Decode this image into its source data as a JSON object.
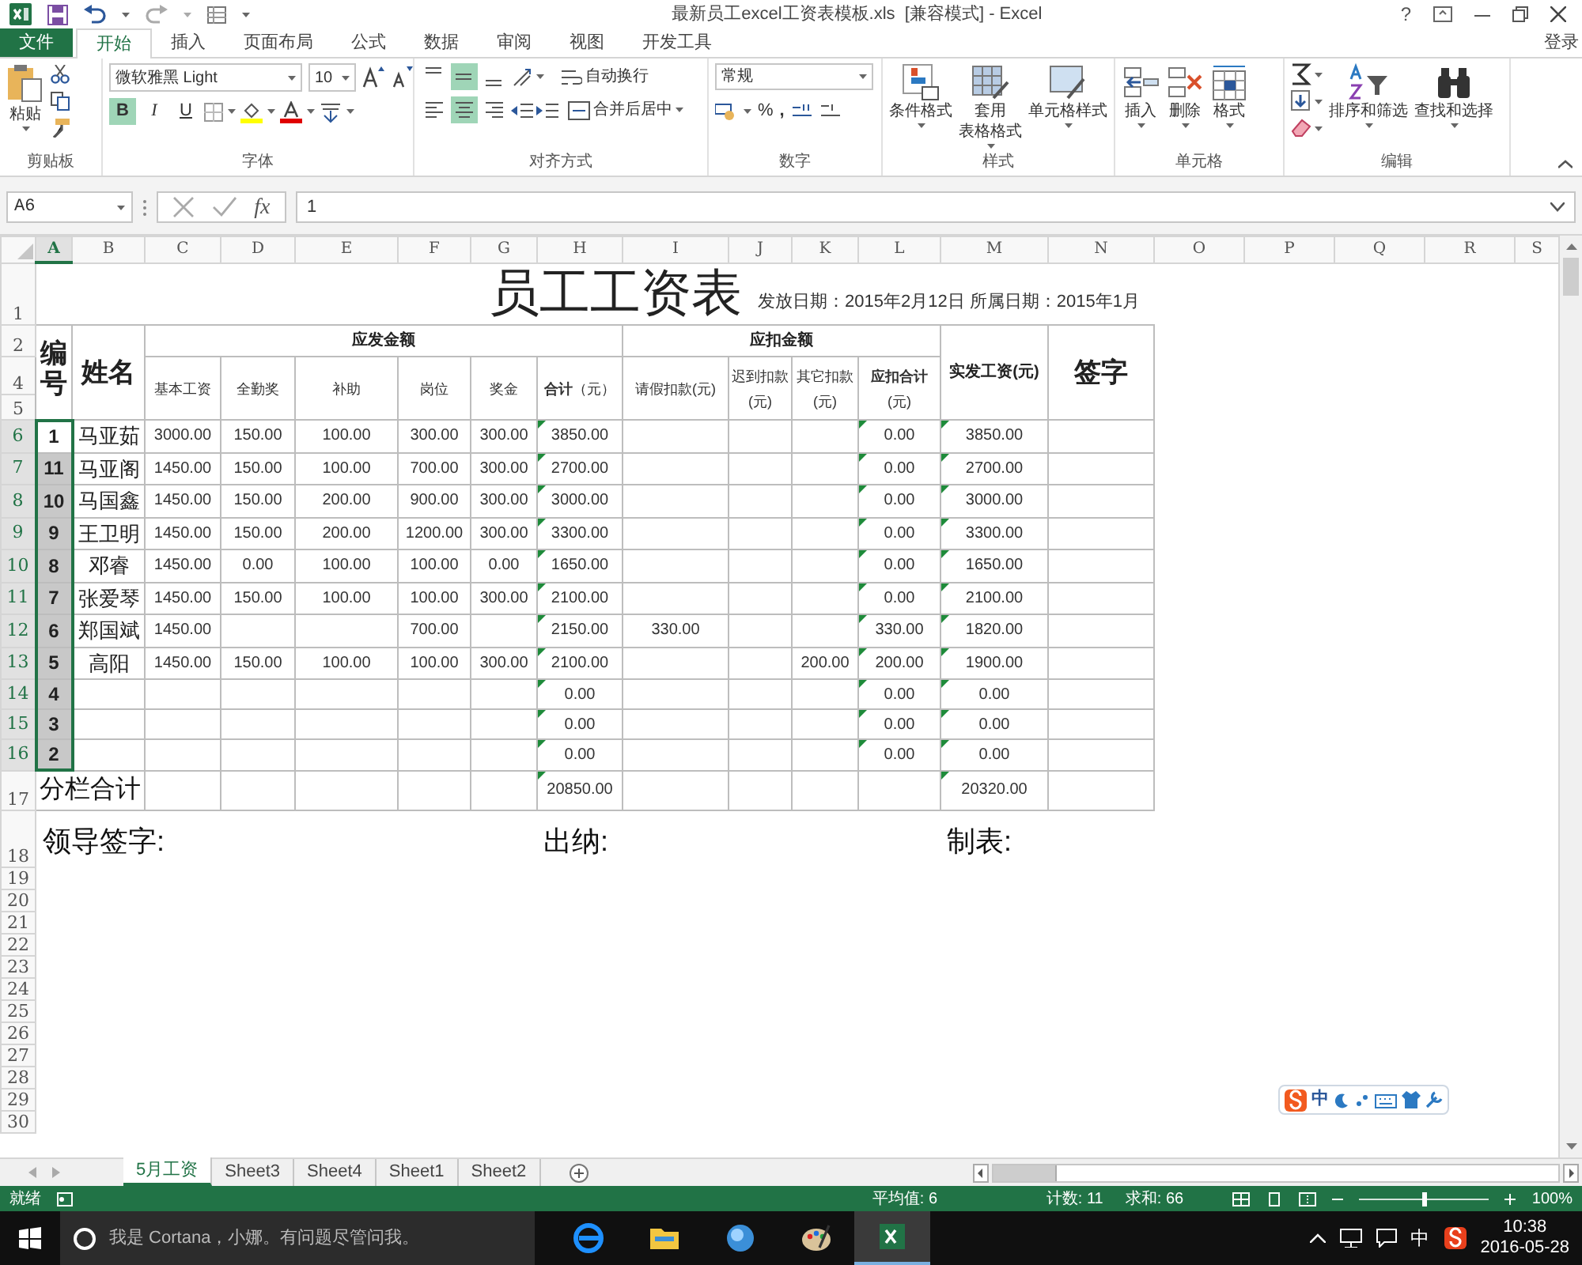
{
  "window": {
    "title": "最新员工excel工资表模板.xls  [兼容模式] - Excel",
    "help": "?",
    "sign_in": "登录"
  },
  "ribbon_tabs": [
    {
      "label": "文件",
      "kind": "file",
      "selected": false
    },
    {
      "label": "开始",
      "kind": "tab",
      "selected": true
    },
    {
      "label": "插入",
      "kind": "tab",
      "selected": false
    },
    {
      "label": "页面布局",
      "kind": "tab",
      "selected": false
    },
    {
      "label": "公式",
      "kind": "tab",
      "selected": false
    },
    {
      "label": "数据",
      "kind": "tab",
      "selected": false
    },
    {
      "label": "审阅",
      "kind": "tab",
      "selected": false
    },
    {
      "label": "视图",
      "kind": "tab",
      "selected": false
    },
    {
      "label": "开发工具",
      "kind": "tab",
      "selected": false
    }
  ],
  "ribbon": {
    "clipboard": {
      "paste": "粘贴",
      "group": "剪贴板"
    },
    "font": {
      "name": "微软雅黑 Light",
      "size": "10",
      "group": "字体",
      "styles": [
        {
          "label": "B",
          "kind": "bold",
          "selected": true
        },
        {
          "label": "I",
          "kind": "italic",
          "selected": false
        },
        {
          "label": "U",
          "kind": "underline",
          "selected": false
        }
      ]
    },
    "alignment": {
      "vertical": [
        {
          "kind": "top",
          "selected": false
        },
        {
          "kind": "middle",
          "selected": true
        },
        {
          "kind": "bottom",
          "selected": false
        }
      ],
      "horizontal": [
        {
          "kind": "left",
          "selected": false
        },
        {
          "kind": "center",
          "selected": true
        },
        {
          "kind": "right",
          "selected": false
        }
      ],
      "wrap": "自动换行",
      "merge": "合并后居中",
      "group": "对齐方式"
    },
    "number": {
      "format": "常规",
      "percent": "%",
      "comma": ",",
      "group": "数字"
    },
    "styles": {
      "conditional": "条件格式",
      "table_line1": "套用",
      "table_line2": "表格格式",
      "cell_styles": "单元格样式",
      "group": "样式"
    },
    "cells": {
      "commands": [
        "插入",
        "删除",
        "格式"
      ],
      "group": "单元格"
    },
    "editing": {
      "sort": "排序和筛选",
      "find": "查找和选择",
      "group": "编辑"
    }
  },
  "formula_bar": {
    "name_box": "A6",
    "function_symbol": "fx",
    "value": "1"
  },
  "column_headers": [
    {
      "label": "A",
      "selected": true
    },
    {
      "label": "B",
      "selected": false
    },
    {
      "label": "C",
      "selected": false
    },
    {
      "label": "D",
      "selected": false
    },
    {
      "label": "E",
      "selected": false
    },
    {
      "label": "F",
      "selected": false
    },
    {
      "label": "G",
      "selected": false
    },
    {
      "label": "H",
      "selected": false
    },
    {
      "label": "I",
      "selected": false
    },
    {
      "label": "J",
      "selected": false
    },
    {
      "label": "K",
      "selected": false
    },
    {
      "label": "L",
      "selected": false
    },
    {
      "label": "M",
      "selected": false
    },
    {
      "label": "N",
      "selected": false
    },
    {
      "label": "O",
      "selected": false
    },
    {
      "label": "P",
      "selected": false
    },
    {
      "label": "Q",
      "selected": false
    },
    {
      "label": "R",
      "selected": false
    },
    {
      "label": "S",
      "selected": false
    }
  ],
  "sheet": {
    "title": "员工工资表",
    "subtitle": "发放日期：2015年2月12日 所属日期：2015年1月",
    "title_row": {
      "label": "1",
      "selected": false
    },
    "header_rows": [
      {
        "label": "2",
        "selected": false
      },
      {
        "label": "4",
        "selected": false
      },
      {
        "label": "5",
        "selected": false
      }
    ],
    "id_header": "编号",
    "name_header": "姓名",
    "sign_header": "签字",
    "header_groups": [
      {
        "kind": "group",
        "label": "应发金额",
        "columns": [
          {
            "header": "基本工资",
            "flagged": false
          },
          {
            "header": "全勤奖",
            "flagged": false
          },
          {
            "header": "补助",
            "flagged": false
          },
          {
            "header": "岗位",
            "flagged": false
          },
          {
            "header": "奖金",
            "flagged": false
          },
          {
            "header": "**合计**（元）",
            "flagged": true
          }
        ]
      },
      {
        "kind": "group",
        "label": "应扣金额",
        "columns": [
          {
            "header": "请假扣款(元)",
            "flagged": false
          },
          {
            "header": "迟到扣款(元)",
            "flagged": false
          },
          {
            "header": "其它扣款(元)",
            "flagged": false
          },
          {
            "header": "**应扣合计**(元)",
            "flagged": true
          }
        ]
      },
      {
        "kind": "single",
        "columns": [
          {
            "header": "实发工资(元)",
            "flagged": true
          }
        ]
      }
    ],
    "rows": [
      {
        "label": "6",
        "selected": true,
        "id": "1",
        "name": "马亚茹",
        "cells": {
          "base": "3000.00",
          "attendance": "150.00",
          "allowance": "100.00",
          "post": "300.00",
          "bonus": "300.00",
          "earn_total": "3850.00",
          "deduct_total": "0.00",
          "net": "3850.00"
        }
      },
      {
        "label": "7",
        "selected": true,
        "id": "11",
        "name": "马亚阁",
        "cells": {
          "base": "1450.00",
          "attendance": "150.00",
          "allowance": "100.00",
          "post": "700.00",
          "bonus": "300.00",
          "earn_total": "2700.00",
          "deduct_total": "0.00",
          "net": "2700.00"
        }
      },
      {
        "label": "8",
        "selected": true,
        "id": "10",
        "name": "马国鑫",
        "cells": {
          "base": "1450.00",
          "attendance": "150.00",
          "allowance": "200.00",
          "post": "900.00",
          "bonus": "300.00",
          "earn_total": "3000.00",
          "deduct_total": "0.00",
          "net": "3000.00"
        }
      },
      {
        "label": "9",
        "selected": true,
        "id": "9",
        "name": "王卫明",
        "cells": {
          "base": "1450.00",
          "attendance": "150.00",
          "allowance": "200.00",
          "post": "1200.00",
          "bonus": "300.00",
          "earn_total": "3300.00",
          "deduct_total": "0.00",
          "net": "3300.00"
        }
      },
      {
        "label": "10",
        "selected": true,
        "id": "8",
        "name": "邓睿",
        "cells": {
          "base": "1450.00",
          "attendance": "0.00",
          "allowance": "100.00",
          "post": "100.00",
          "bonus": "0.00",
          "earn_total": "1650.00",
          "deduct_total": "0.00",
          "net": "1650.00"
        }
      },
      {
        "label": "11",
        "selected": true,
        "id": "7",
        "name": "张爱琴",
        "cells": {
          "base": "1450.00",
          "attendance": "150.00",
          "allowance": "100.00",
          "post": "100.00",
          "bonus": "300.00",
          "earn_total": "2100.00",
          "deduct_total": "0.00",
          "net": "2100.00"
        }
      },
      {
        "label": "12",
        "selected": true,
        "id": "6",
        "name": "郑国斌",
        "cells": {
          "base": "1450.00",
          "post": "700.00",
          "earn_total": "2150.00",
          "leave": "330.00",
          "deduct_total": "330.00",
          "net": "1820.00"
        }
      },
      {
        "label": "13",
        "selected": true,
        "id": "5",
        "name": "高阳",
        "cells": {
          "base": "1450.00",
          "attendance": "150.00",
          "allowance": "100.00",
          "post": "100.00",
          "bonus": "300.00",
          "earn_total": "2100.00",
          "other": "200.00",
          "deduct_total": "200.00",
          "net": "1900.00"
        }
      },
      {
        "label": "14",
        "selected": true,
        "id": "4",
        "cells": {
          "earn_total": "0.00",
          "deduct_total": "0.00",
          "net": "0.00"
        }
      },
      {
        "label": "15",
        "selected": true,
        "id": "3",
        "cells": {
          "earn_total": "0.00",
          "deduct_total": "0.00",
          "net": "0.00"
        }
      },
      {
        "label": "16",
        "selected": true,
        "id": "2",
        "cells": {
          "earn_total": "0.00",
          "deduct_total": "0.00",
          "net": "0.00"
        }
      }
    ],
    "total_row": {
      "label": "17",
      "selected": false,
      "title": "分栏合计",
      "cells": {
        "earn_total": "20850.00",
        "net": "20320.00"
      }
    },
    "signature_row": {
      "label": "18",
      "selected": false,
      "leader": "领导签字:",
      "cashier": "出纳:",
      "maker": "制表:"
    },
    "empty_rows": [
      {
        "label": "19",
        "selected": false
      },
      {
        "label": "20",
        "selected": false
      },
      {
        "label": "21",
        "selected": false
      },
      {
        "label": "22",
        "selected": false
      },
      {
        "label": "23",
        "selected": false
      },
      {
        "label": "24",
        "selected": false
      },
      {
        "label": "25",
        "selected": false
      },
      {
        "label": "26",
        "selected": false
      },
      {
        "label": "27",
        "selected": false
      },
      {
        "label": "28",
        "selected": false
      },
      {
        "label": "29",
        "selected": false
      },
      {
        "label": "30",
        "selected": false
      }
    ]
  },
  "ime_toolbar": {
    "mode": "中"
  },
  "sheet_tabs": [
    {
      "label": "5月工资",
      "selected": true
    },
    {
      "label": "Sheet3",
      "selected": false
    },
    {
      "label": "Sheet4",
      "selected": false
    },
    {
      "label": "Sheet1",
      "selected": false
    },
    {
      "label": "Sheet2",
      "selected": false
    }
  ],
  "status_bar": {
    "ready": "就绪",
    "average": "平均值: 6",
    "count": "计数: 11",
    "sum": "求和: 66",
    "zoom": "100%",
    "zoom_slider": {
      "level": 0.5
    }
  },
  "taskbar": {
    "search_placeholder": "我是 Cortana，小娜。有问题尽管问我。",
    "ime": "中",
    "time": "10:38",
    "date": "2016-05-28"
  }
}
